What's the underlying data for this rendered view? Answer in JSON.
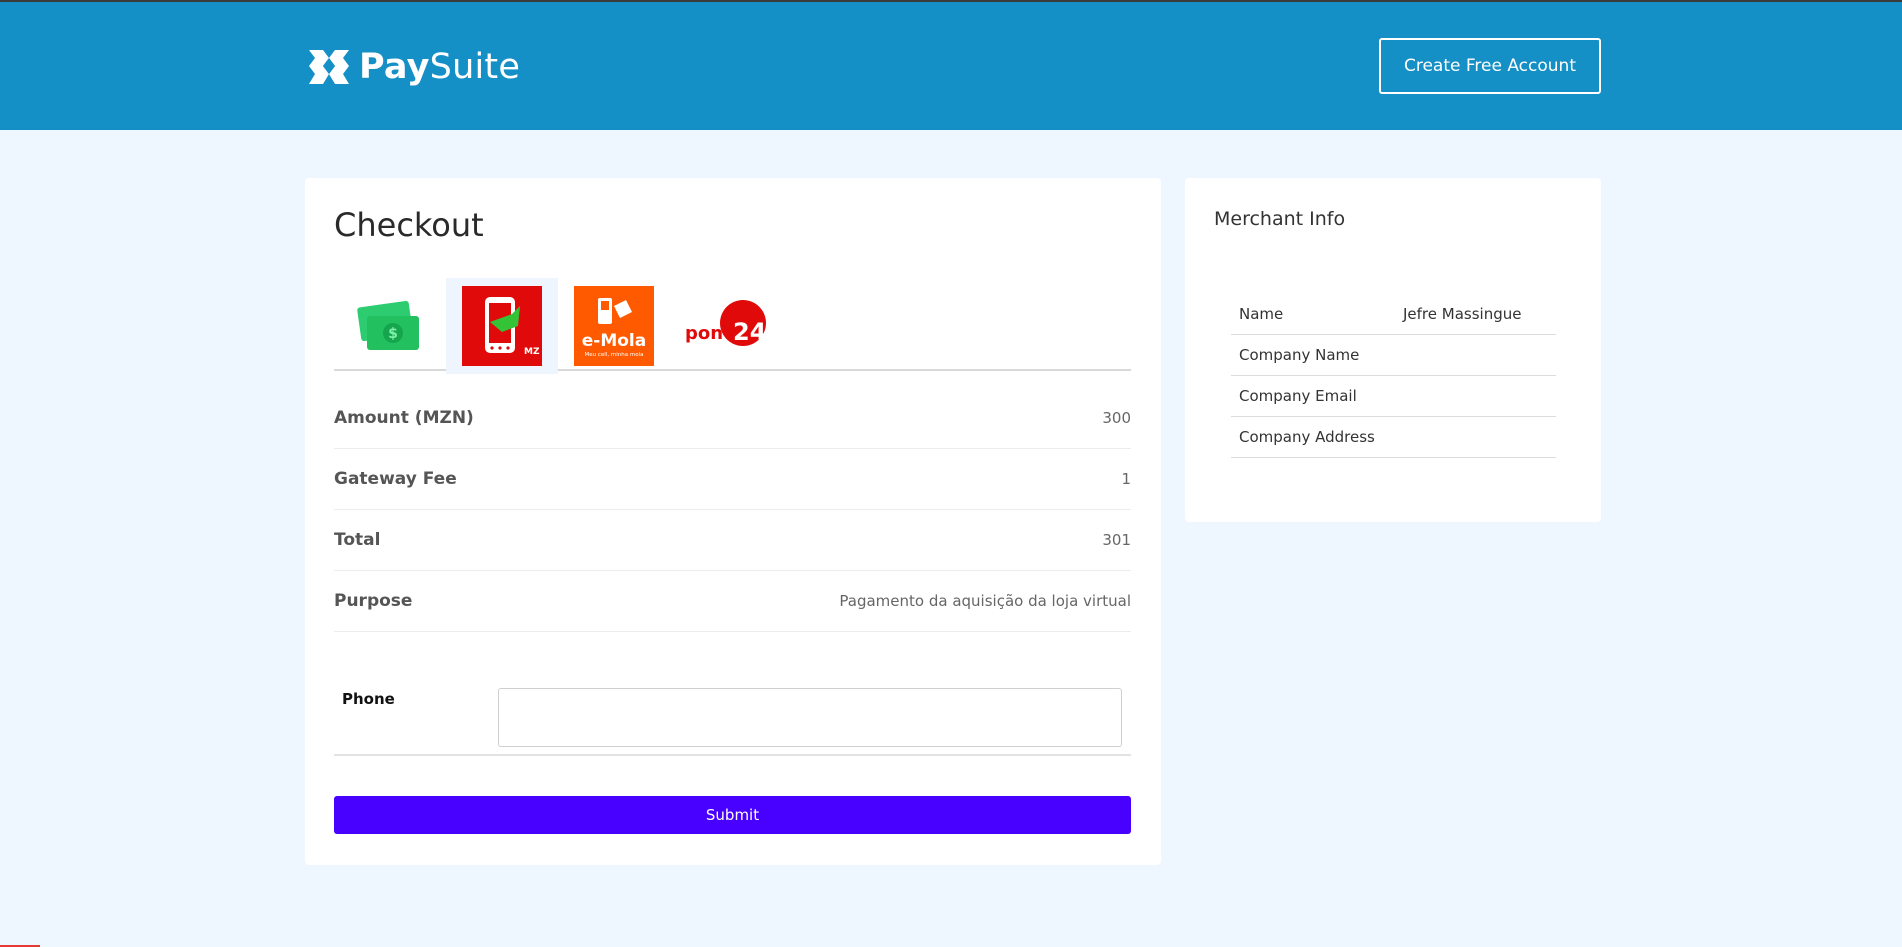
{
  "header": {
    "brand_bold": "Pay",
    "brand_light": "Suite",
    "cta_label": "Create Free Account",
    "bg_color": "#1590c6"
  },
  "checkout": {
    "title": "Checkout",
    "methods": [
      {
        "name": "cash-icon",
        "label": ""
      },
      {
        "name": "mpesa-icon",
        "label": "MZ",
        "active": true
      },
      {
        "name": "emola-icon",
        "label": "e-Mola",
        "tagline": "Meu cell, minha mola"
      },
      {
        "name": "ponto24-icon",
        "label": "pont",
        "number": "24"
      }
    ],
    "rows": [
      {
        "key": "Amount (MZN)",
        "value": "300"
      },
      {
        "key": "Gateway Fee",
        "value": "1"
      },
      {
        "key": "Total",
        "value": "301"
      },
      {
        "key": "Purpose",
        "value": "Pagamento da aquisição da loja virtual"
      }
    ],
    "phone": {
      "label": "Phone",
      "value": "",
      "placeholder": ""
    },
    "submit_label": "Submit",
    "submit_color": "#4800ff"
  },
  "merchant": {
    "title": "Merchant Info",
    "rows": [
      {
        "key": "Name",
        "value": "Jefre Massingue"
      },
      {
        "key": "Company Name",
        "value": ""
      },
      {
        "key": "Company Email",
        "value": ""
      },
      {
        "key": "Company Address",
        "value": ""
      }
    ]
  }
}
